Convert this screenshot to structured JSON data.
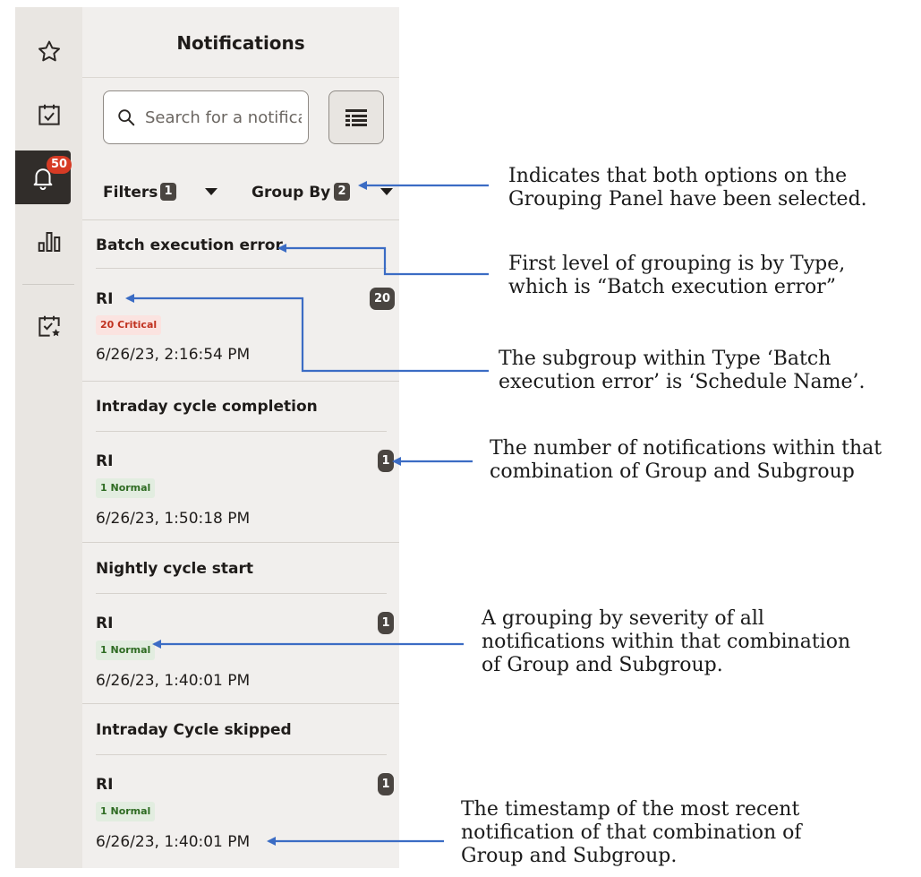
{
  "rail": {
    "items": [
      {
        "icon": "star-icon"
      },
      {
        "icon": "calendar-check-icon"
      },
      {
        "icon": "bell-icon",
        "badge": "50"
      },
      {
        "icon": "bar-chart-icon"
      },
      {
        "icon": "calendar-star-icon"
      }
    ]
  },
  "panel": {
    "title": "Notifications",
    "search_placeholder": "Search for a notification",
    "filters_label": "Filters",
    "filters_count": "1",
    "group_by_label": "Group By",
    "group_by_count": "2"
  },
  "groups": [
    {
      "title": "Batch execution error",
      "subgroup": "RI",
      "count": "20",
      "severity": "20 Critical",
      "severity_level": "critical",
      "timestamp": "6/26/23, 2:16:54 PM"
    },
    {
      "title": "Intraday cycle completion",
      "subgroup": "RI",
      "count": "1",
      "severity": "1 Normal",
      "severity_level": "normal",
      "timestamp": "6/26/23, 1:50:18 PM"
    },
    {
      "title": "Nightly cycle start",
      "subgroup": "RI",
      "count": "1",
      "severity": "1 Normal",
      "severity_level": "normal",
      "timestamp": "6/26/23, 1:40:01 PM"
    },
    {
      "title": "Intraday Cycle skipped",
      "subgroup": "RI",
      "count": "1",
      "severity": "1 Normal",
      "severity_level": "normal",
      "timestamp": "6/26/23, 1:40:01 PM"
    }
  ],
  "annotations": {
    "a1": [
      "Indicates that both options on the",
      "Grouping Panel have been selected."
    ],
    "a2": [
      "First level of grouping is by Type,",
      "which is “Batch execution error”"
    ],
    "a3": [
      "The subgroup within Type ‘Batch",
      "execution error’ is ‘Schedule Name’."
    ],
    "a4": [
      "The number of notifications within that",
      "combination of Group and Subgroup"
    ],
    "a5": [
      "A grouping by severity of all",
      "notifications within that combination",
      "of Group and Subgroup."
    ],
    "a6": [
      "The timestamp of the most recent",
      "notification of that combination of",
      "Group and Subgroup."
    ]
  },
  "colors": {
    "accent_arrow": "#3b6cc4",
    "badge_red": "#d63b25",
    "critical_text": "#c0311f",
    "normal_text": "#2e6b22"
  }
}
